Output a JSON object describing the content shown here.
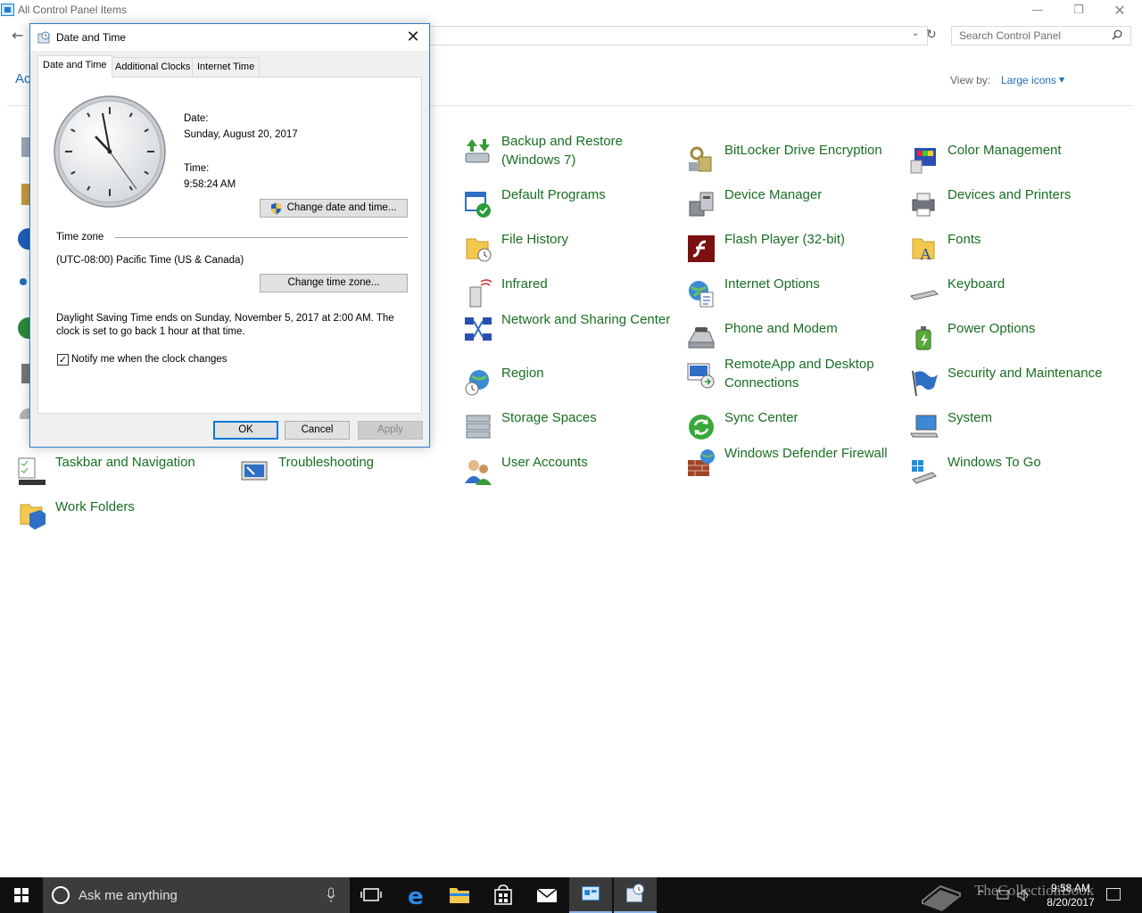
{
  "control_panel": {
    "title": "All Control Panel Items",
    "heading": "Ac",
    "search_placeholder": "Search Control Panel",
    "view_by_label": "View by:",
    "view_by_value": "Large icons",
    "items": [
      {
        "label": "Backup and Restore (Windows 7)",
        "icon": "backup-restore-icon"
      },
      {
        "label": "BitLocker Drive Encryption",
        "icon": "bitlocker-icon"
      },
      {
        "label": "Color Management",
        "icon": "color-management-icon"
      },
      {
        "label": "Default Programs",
        "icon": "default-programs-icon"
      },
      {
        "label": "Device Manager",
        "icon": "device-manager-icon"
      },
      {
        "label": "Devices and Printers",
        "icon": "printer-icon"
      },
      {
        "label": "File History",
        "icon": "file-history-icon"
      },
      {
        "label": "Flash Player (32-bit)",
        "icon": "flash-player-icon"
      },
      {
        "label": "Fonts",
        "icon": "fonts-icon"
      },
      {
        "label": "Infrared",
        "icon": "infrared-icon"
      },
      {
        "label": "Internet Options",
        "icon": "internet-options-icon"
      },
      {
        "label": "Keyboard",
        "icon": "keyboard-icon"
      },
      {
        "label": "Network and Sharing Center",
        "icon": "network-icon"
      },
      {
        "label": "Phone and Modem",
        "icon": "phone-modem-icon"
      },
      {
        "label": "Power Options",
        "icon": "power-options-icon"
      },
      {
        "label": "Region",
        "icon": "region-icon"
      },
      {
        "label": "RemoteApp and Desktop Connections",
        "icon": "remoteapp-icon"
      },
      {
        "label": "Security and Maintenance",
        "icon": "security-flag-icon"
      },
      {
        "label": "Storage Spaces",
        "icon": "storage-spaces-icon"
      },
      {
        "label": "Sync Center",
        "icon": "sync-center-icon"
      },
      {
        "label": "System",
        "icon": "system-icon"
      },
      {
        "label": "Taskbar and Navigation",
        "icon": "taskbar-icon"
      },
      {
        "label": "Troubleshooting",
        "icon": "troubleshooting-icon"
      },
      {
        "label": "User Accounts",
        "icon": "user-accounts-icon"
      },
      {
        "label": "Windows Defender Firewall",
        "icon": "firewall-icon"
      },
      {
        "label": "Windows To Go",
        "icon": "windows-to-go-icon"
      },
      {
        "label": "Work Folders",
        "icon": "work-folders-icon"
      }
    ]
  },
  "dialog": {
    "title": "Date and Time",
    "tabs": [
      "Date and Time",
      "Additional Clocks",
      "Internet Time"
    ],
    "date_label": "Date:",
    "date_value": "Sunday, August 20, 2017",
    "time_label": "Time:",
    "time_value": "9:58:24 AM",
    "change_datetime_button": "Change date and time...",
    "timezone_label": "Time zone",
    "timezone_value": "(UTC-08:00) Pacific Time (US & Canada)",
    "change_timezone_button": "Change time zone...",
    "dst_text": "Daylight Saving Time ends on Sunday, November 5, 2017 at 2:00 AM. The clock is set to go back 1 hour at that time.",
    "notify_label": "Notify me when the clock changes",
    "notify_checked": true,
    "ok_button": "OK",
    "cancel_button": "Cancel",
    "apply_button": "Apply"
  },
  "taskbar": {
    "search_text": "Ask me anything",
    "clock_time": "9:58 AM",
    "clock_date": "8/20/2017",
    "watermark": "TheCollectionBook"
  },
  "colors": {
    "link_green": "#196e22",
    "accent_blue": "#0078d7",
    "taskbar": "#101010"
  }
}
